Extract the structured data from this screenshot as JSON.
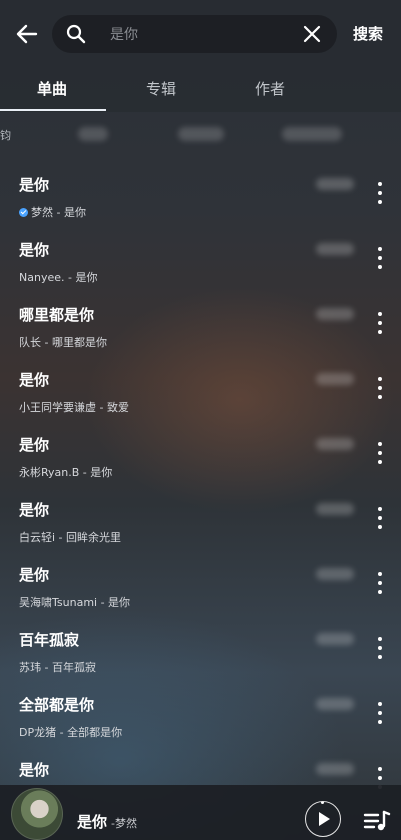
{
  "search": {
    "placeholder": "是你",
    "action_label": "搜索"
  },
  "tabs": [
    {
      "label": "单曲",
      "active": true
    },
    {
      "label": "专辑",
      "active": false
    },
    {
      "label": "作者",
      "active": false
    }
  ],
  "filter_row": {
    "cut_text": "钧"
  },
  "songs": [
    {
      "title": "是你",
      "subtitle": "梦然 - 是你",
      "verified": true
    },
    {
      "title": "是你",
      "subtitle": "Nanyee. - 是你",
      "verified": false
    },
    {
      "title": "哪里都是你",
      "subtitle": "队长 - 哪里都是你",
      "verified": false
    },
    {
      "title": "是你",
      "subtitle": "小王同学要谦虚 - 致爱",
      "verified": false
    },
    {
      "title": "是你",
      "subtitle": "永彬Ryan.B - 是你",
      "verified": false
    },
    {
      "title": "是你",
      "subtitle": "白云轻i - 回眸余光里",
      "verified": false
    },
    {
      "title": "是你",
      "subtitle": "吴海啸Tsunami - 是你",
      "verified": false
    },
    {
      "title": "百年孤寂",
      "subtitle": "苏玮 - 百年孤寂",
      "verified": false
    },
    {
      "title": "全部都是你",
      "subtitle": "DP龙猪 - 全部都是你",
      "verified": false
    },
    {
      "title": "是你",
      "subtitle": "",
      "verified": false
    }
  ],
  "player": {
    "title": "是你",
    "artist": "-梦然"
  },
  "colors": {
    "accent_underline": "#e9eef5",
    "verified": "#4aa3ff"
  },
  "icons": [
    "back-arrow-icon",
    "search-icon",
    "clear-icon",
    "more-vertical-icon",
    "play-icon",
    "playlist-icon"
  ]
}
